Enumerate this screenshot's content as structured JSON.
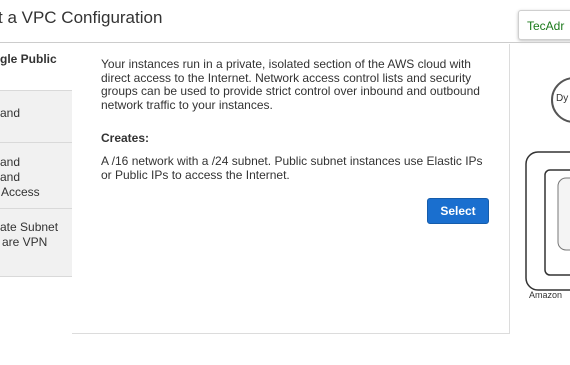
{
  "header": {
    "title": "t a VPC Configuration",
    "badge": "TecAdr"
  },
  "tabs": [
    {
      "lines": [
        "gle Public"
      ],
      "active": true
    },
    {
      "lines": [
        "and"
      ]
    },
    {
      "lines": [
        "and",
        "and",
        "Access"
      ]
    },
    {
      "lines": [
        "ate Subnet",
        "are VPN"
      ]
    }
  ],
  "main": {
    "description": "Your instances run in a private, isolated section of the AWS cloud with direct access to the Internet. Network access control lists and security groups can be used to provide strict control over inbound and outbound network traffic to your instances.",
    "creates_label": "Creates:",
    "creates_text": "A /16 network with a /24 subnet. Public subnet instances use Elastic IPs or Public IPs to access the Internet.",
    "select_label": "Select"
  },
  "diagram": {
    "circle_label": "Dy",
    "bottom_label": "Amazon",
    "colors": {
      "stroke": "#333333",
      "inner_fill": "#f4f4f4"
    }
  }
}
